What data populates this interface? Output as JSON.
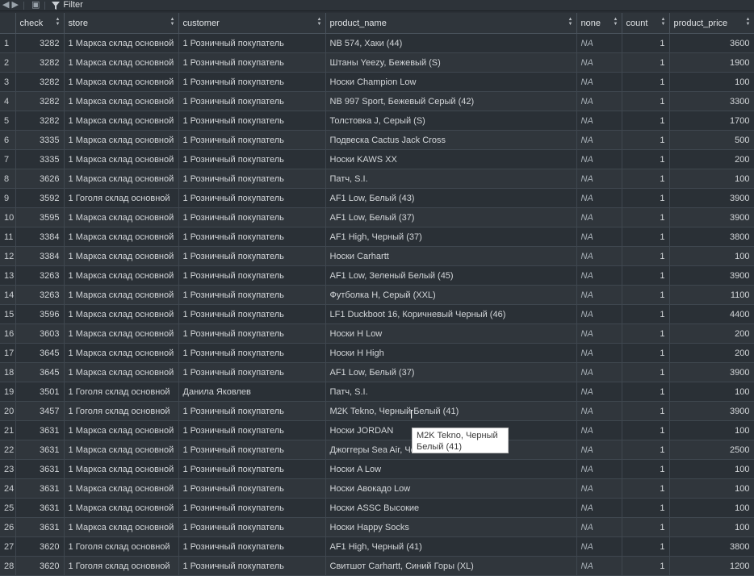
{
  "toolbar": {
    "filter_label": "Filter"
  },
  "columns": [
    "check",
    "store",
    "customer",
    "product_name",
    "none",
    "count",
    "product_price"
  ],
  "rows": [
    {
      "i": "1",
      "check": "3282",
      "store": "1 Маркса склад основной",
      "customer": "1 Розничный покупатель",
      "product": "NB 574, Хаки (44)",
      "none": "NA",
      "count": "1",
      "price": "3600"
    },
    {
      "i": "2",
      "check": "3282",
      "store": "1 Маркса склад основной",
      "customer": "1 Розничный покупатель",
      "product": "Штаны Yeezy, Бежевый (S)",
      "none": "NA",
      "count": "1",
      "price": "1900"
    },
    {
      "i": "3",
      "check": "3282",
      "store": "1 Маркса склад основной",
      "customer": "1 Розничный покупатель",
      "product": "Носки Champion Low",
      "none": "NA",
      "count": "1",
      "price": "100"
    },
    {
      "i": "4",
      "check": "3282",
      "store": "1 Маркса склад основной",
      "customer": "1 Розничный покупатель",
      "product": "NB 997 Sport, Бежевый Серый (42)",
      "none": "NA",
      "count": "1",
      "price": "3300"
    },
    {
      "i": "5",
      "check": "3282",
      "store": "1 Маркса склад основной",
      "customer": "1 Розничный покупатель",
      "product": "Толстовка J, Серый (S)",
      "none": "NA",
      "count": "1",
      "price": "1700"
    },
    {
      "i": "6",
      "check": "3335",
      "store": "1 Маркса склад основной",
      "customer": "1 Розничный покупатель",
      "product": "Подвеска Cactus Jack Cross",
      "none": "NA",
      "count": "1",
      "price": "500"
    },
    {
      "i": "7",
      "check": "3335",
      "store": "1 Маркса склад основной",
      "customer": "1 Розничный покупатель",
      "product": "Носки KAWS XX",
      "none": "NA",
      "count": "1",
      "price": "200"
    },
    {
      "i": "8",
      "check": "3626",
      "store": "1 Маркса склад основной",
      "customer": "1 Розничный покупатель",
      "product": "Патч, S.I.",
      "none": "NA",
      "count": "1",
      "price": "100"
    },
    {
      "i": "9",
      "check": "3592",
      "store": "1 Гоголя склад основной",
      "customer": "1 Розничный покупатель",
      "product": "AF1 Low, Белый (43)",
      "none": "NA",
      "count": "1",
      "price": "3900"
    },
    {
      "i": "10",
      "check": "3595",
      "store": "1 Маркса склад основной",
      "customer": "1 Розничный покупатель",
      "product": "AF1 Low, Белый (37)",
      "none": "NA",
      "count": "1",
      "price": "3900"
    },
    {
      "i": "11",
      "check": "3384",
      "store": "1 Маркса склад основной",
      "customer": "1 Розничный покупатель",
      "product": "AF1 High, Черный (37)",
      "none": "NA",
      "count": "1",
      "price": "3800"
    },
    {
      "i": "12",
      "check": "3384",
      "store": "1 Маркса склад основной",
      "customer": "1 Розничный покупатель",
      "product": "Носки Carhartt",
      "none": "NA",
      "count": "1",
      "price": "100"
    },
    {
      "i": "13",
      "check": "3263",
      "store": "1 Маркса склад основной",
      "customer": "1 Розничный покупатель",
      "product": "AF1 Low, Зеленый Белый (45)",
      "none": "NA",
      "count": "1",
      "price": "3900"
    },
    {
      "i": "14",
      "check": "3263",
      "store": "1 Маркса склад основной",
      "customer": "1 Розничный покупатель",
      "product": "Футболка H, Серый (XXL)",
      "none": "NA",
      "count": "1",
      "price": "1100"
    },
    {
      "i": "15",
      "check": "3596",
      "store": "1 Маркса склад основной",
      "customer": "1 Розничный покупатель",
      "product": "LF1 Duckboot 16, Коричневый Черный (46)",
      "none": "NA",
      "count": "1",
      "price": "4400"
    },
    {
      "i": "16",
      "check": "3603",
      "store": "1 Маркса склад основной",
      "customer": "1 Розничный покупатель",
      "product": "Носки H Low",
      "none": "NA",
      "count": "1",
      "price": "200"
    },
    {
      "i": "17",
      "check": "3645",
      "store": "1 Маркса склад основной",
      "customer": "1 Розничный покупатель",
      "product": "Носки H High",
      "none": "NA",
      "count": "1",
      "price": "200"
    },
    {
      "i": "18",
      "check": "3645",
      "store": "1 Маркса склад основной",
      "customer": "1 Розничный покупатель",
      "product": "AF1 Low, Белый (37)",
      "none": "NA",
      "count": "1",
      "price": "3900"
    },
    {
      "i": "19",
      "check": "3501",
      "store": "1 Гоголя склад основной",
      "customer": "Данила Яковлев",
      "product": "Патч, S.I.",
      "none": "NA",
      "count": "1",
      "price": "100"
    },
    {
      "i": "20",
      "check": "3457",
      "store": "1 Гоголя склад основной",
      "customer": "1 Розничный покупатель",
      "product": "M2K Tekno, Черный Белый (41)",
      "none": "NA",
      "count": "1",
      "price": "3900"
    },
    {
      "i": "21",
      "check": "3631",
      "store": "1 Маркса склад основной",
      "customer": "1 Розничный покупатель",
      "product": "Носки JORDAN",
      "none": "NA",
      "count": "1",
      "price": "100"
    },
    {
      "i": "22",
      "check": "3631",
      "store": "1 Маркса склад основной",
      "customer": "1 Розничный покупатель",
      "product": "Джоггеры Sea Air, Че",
      "none": "NA",
      "count": "1",
      "price": "2500"
    },
    {
      "i": "23",
      "check": "3631",
      "store": "1 Маркса склад основной",
      "customer": "1 Розничный покупатель",
      "product": "Носки A Low",
      "none": "NA",
      "count": "1",
      "price": "100"
    },
    {
      "i": "24",
      "check": "3631",
      "store": "1 Маркса склад основной",
      "customer": "1 Розничный покупатель",
      "product": "Носки Авокадо Low",
      "none": "NA",
      "count": "1",
      "price": "100"
    },
    {
      "i": "25",
      "check": "3631",
      "store": "1 Маркса склад основной",
      "customer": "1 Розничный покупатель",
      "product": "Носки ASSC Высокие",
      "none": "NA",
      "count": "1",
      "price": "100"
    },
    {
      "i": "26",
      "check": "3631",
      "store": "1 Маркса склад основной",
      "customer": "1 Розничный покупатель",
      "product": "Носки Happy Socks",
      "none": "NA",
      "count": "1",
      "price": "100"
    },
    {
      "i": "27",
      "check": "3620",
      "store": "1 Гоголя склад основной",
      "customer": "1 Розничный покупатель",
      "product": "AF1 High, Черный (41)",
      "none": "NA",
      "count": "1",
      "price": "3800"
    },
    {
      "i": "28",
      "check": "3620",
      "store": "1 Гоголя склад основной",
      "customer": "1 Розничный покупатель",
      "product": "Свитшот Carhartt, Синий Горы (XL)",
      "none": "NA",
      "count": "1",
      "price": "1200"
    }
  ],
  "tooltip": {
    "text": "M2K Tekno, Черный Белый (41)"
  }
}
